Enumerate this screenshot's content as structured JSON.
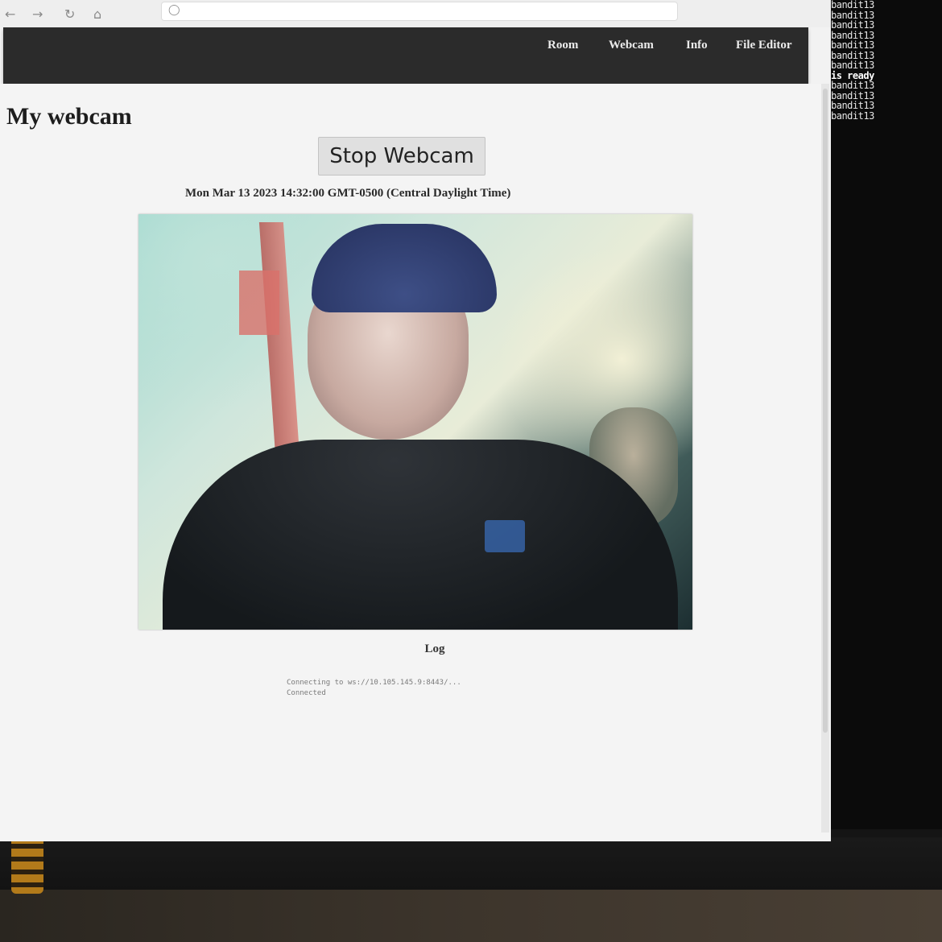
{
  "browser": {
    "toolbar": {
      "back_icon": "←",
      "forward_icon": "→",
      "reload_icon": "↻",
      "home_icon": "⌂",
      "shield_icon": "◯",
      "address_text": ""
    },
    "nav": {
      "items": [
        {
          "label": "Room"
        },
        {
          "label": "Webcam"
        },
        {
          "label": "Info"
        },
        {
          "label": "File Editor"
        }
      ]
    }
  },
  "page": {
    "title": "My webcam",
    "stop_button_label": "Stop Webcam",
    "timestamp": "Mon Mar 13 2023 14:32:00 GMT-0500 (Central Daylight Time)",
    "log_heading": "Log",
    "log_lines": [
      "Connecting to ws://10.105.145.9:8443/...",
      "Connected"
    ]
  },
  "terminal": {
    "lines": [
      "bandit13 ",
      "bandit13 ",
      "bandit13 ",
      "bandit13 ",
      "bandit13 ",
      "bandit13 ",
      "bandit13 ",
      "is ready",
      "bandit13 ",
      "bandit13 ",
      "bandit13 ",
      "bandit13 "
    ]
  },
  "colors": {
    "navbar_bg": "#2b2b2b",
    "page_bg": "#f4f4f4",
    "terminal_bg": "#0b0b0b"
  }
}
